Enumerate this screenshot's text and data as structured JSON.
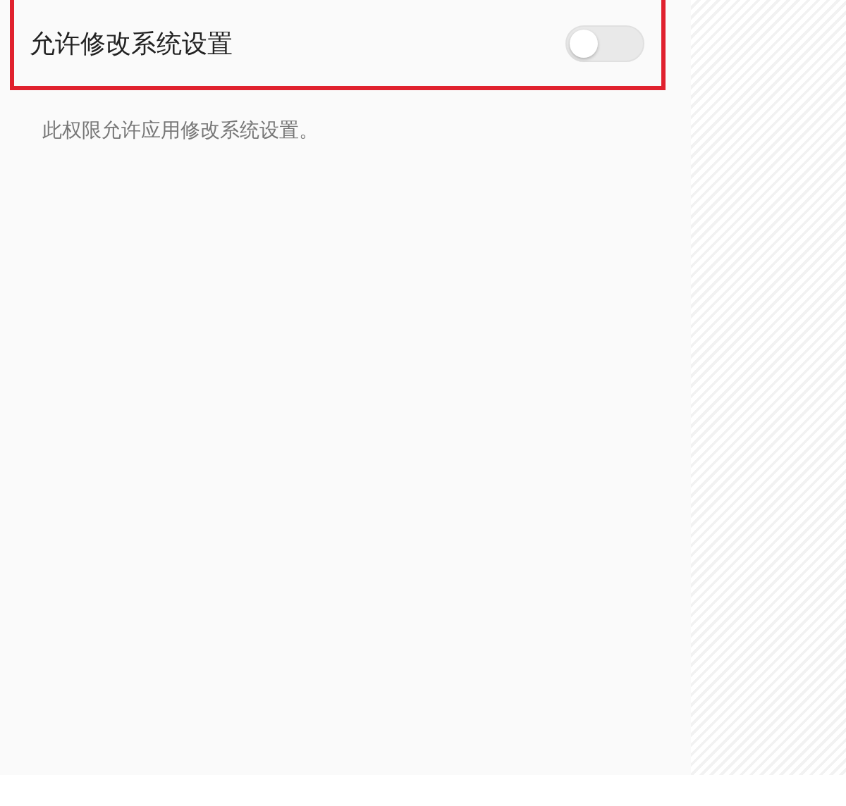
{
  "setting": {
    "label": "允许修改系统设置",
    "on": false
  },
  "description": "此权限允许应用修改系统设置。"
}
